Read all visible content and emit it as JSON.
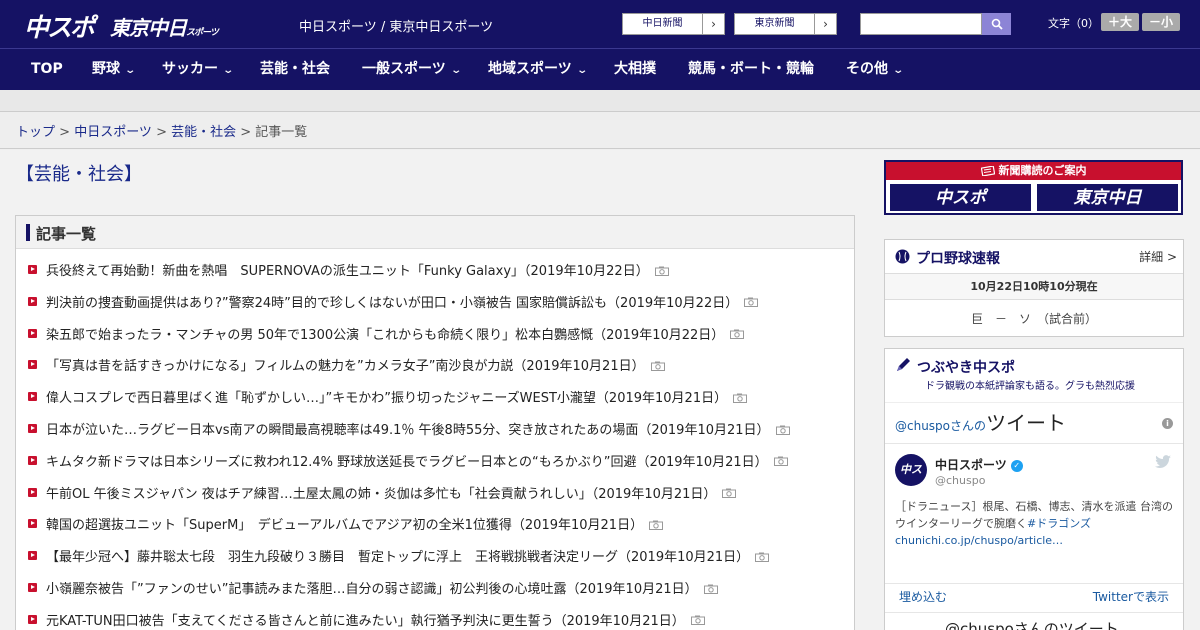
{
  "header": {
    "logo_chuspo": "中スポ",
    "logo_tokyo": "東京中日",
    "logo_tokyo_small": "スポーツ",
    "tagline": "中日スポーツ / 東京中日スポーツ",
    "paper_buttons": [
      "中日新聞",
      "東京新聞"
    ],
    "arrow": "›",
    "search_placeholder": "",
    "font_label": "文字（0）",
    "font_larger": "＋大",
    "font_smaller": "－小"
  },
  "nav": [
    {
      "label": "TOP",
      "has_menu": false
    },
    {
      "label": "野球",
      "has_menu": true
    },
    {
      "label": "サッカー",
      "has_menu": true
    },
    {
      "label": "芸能・社会",
      "has_menu": false
    },
    {
      "label": "一般スポーツ",
      "has_menu": true
    },
    {
      "label": "地域スポーツ",
      "has_menu": true
    },
    {
      "label": "大相撲",
      "has_menu": false
    },
    {
      "label": "競馬・ボート・競輪",
      "has_menu": false
    },
    {
      "label": "その他",
      "has_menu": true
    }
  ],
  "breadcrumb": {
    "items": [
      "トップ",
      "中日スポーツ",
      "芸能・社会"
    ],
    "sep": " > ",
    "current": "記事一覧"
  },
  "page_title": "【芸能・社会】",
  "list_heading": "記事一覧",
  "articles": [
    "兵役終えて再始動！新曲を熱唱　SUPERNOVAの派生ユニット「Funky Galaxy」（2019年10月22日）",
    "判決前の捜査動画提供はあり?”警察24時”目的で珍しくはないが田口・小嶺被告 国家賠償訴訟も（2019年10月22日）",
    "染五郎で始まったラ・マンチャの男 50年で1300公演「これからも命続く限り」松本白鸚感慨（2019年10月22日）",
    "「写真は昔を話すきっかけになる」フィルムの魅力を”カメラ女子”南沙良が力説（2019年10月21日）",
    "偉人コスプレで西日暮里ばく進「恥ずかしい…」”キモかわ”振り切ったジャニーズWEST小瀧望（2019年10月21日）",
    "日本が泣いた…ラグビー日本vs南アの瞬間最高視聴率は49.1％ 午後8時55分、突き放されたあの場面（2019年10月21日）",
    "キムタク新ドラマは日本シリーズに救われ12.4% 野球放送延長でラグビー日本との“もろかぶり”回避（2019年10月21日）",
    "午前OL 午後ミスジャパン 夜はチア練習…土屋太鳳の姉・炎伽は多忙も「社会貢献うれしい」（2019年10月21日）",
    "韓国の超選抜ユニット「SuperM」　デビューアルバムでアジア初の全米1位獲得（2019年10月21日）",
    "【最年少冠へ】藤井聡太七段　羽生九段破り３勝目　暫定トップに浮上　王将戦挑戦者決定リーグ（2019年10月21日）",
    "小嶺麗奈被告「”ファンのせい”記事読みまた落胆…自分の弱さ認識」初公判後の心境吐露（2019年10月21日）",
    "元KAT-TUN田口被告「支えてくださる皆さんと前に進みたい」執行猶予判決に更生誓う（2019年10月21日）"
  ],
  "sidebar": {
    "subs_head": "新聞購読のご案内",
    "subs_logos": [
      "中スポ",
      "東京中日"
    ],
    "score_title": "プロ野球速報",
    "score_more": "詳細 >",
    "score_time": "10月22日10時10分現在",
    "score_game": "巨　－　ソ　（試合前）",
    "tw_title": "つぶやき中スポ",
    "tw_sub": "ドラ観戦の本紙評論家も語る。グラも熱烈応援",
    "tw_hdr_pre": "@chuspoさんの",
    "tw_hdr_big": "ツイート",
    "tw_info": "i",
    "tw_avatar": "中スポ",
    "tw_name": "中日スポーツ",
    "tw_handle": "@chuspo",
    "tw_text_plain": "［ドラニュース］根尾、石橋、博志、清水を派遣 台湾のウインターリーグで腕磨く",
    "tw_text_tag": "#ドラゴンズ",
    "tw_text_link": "chunichi.co.jp/chuspo/article…",
    "tw_embed": "埋め込む",
    "tw_view": "Twitterで表示",
    "tw_next": "@chuspoさんのツイート"
  },
  "colors": {
    "brand_navy": "#151264",
    "accent_red": "#c8102e",
    "link_blue": "#1a2a8a"
  }
}
